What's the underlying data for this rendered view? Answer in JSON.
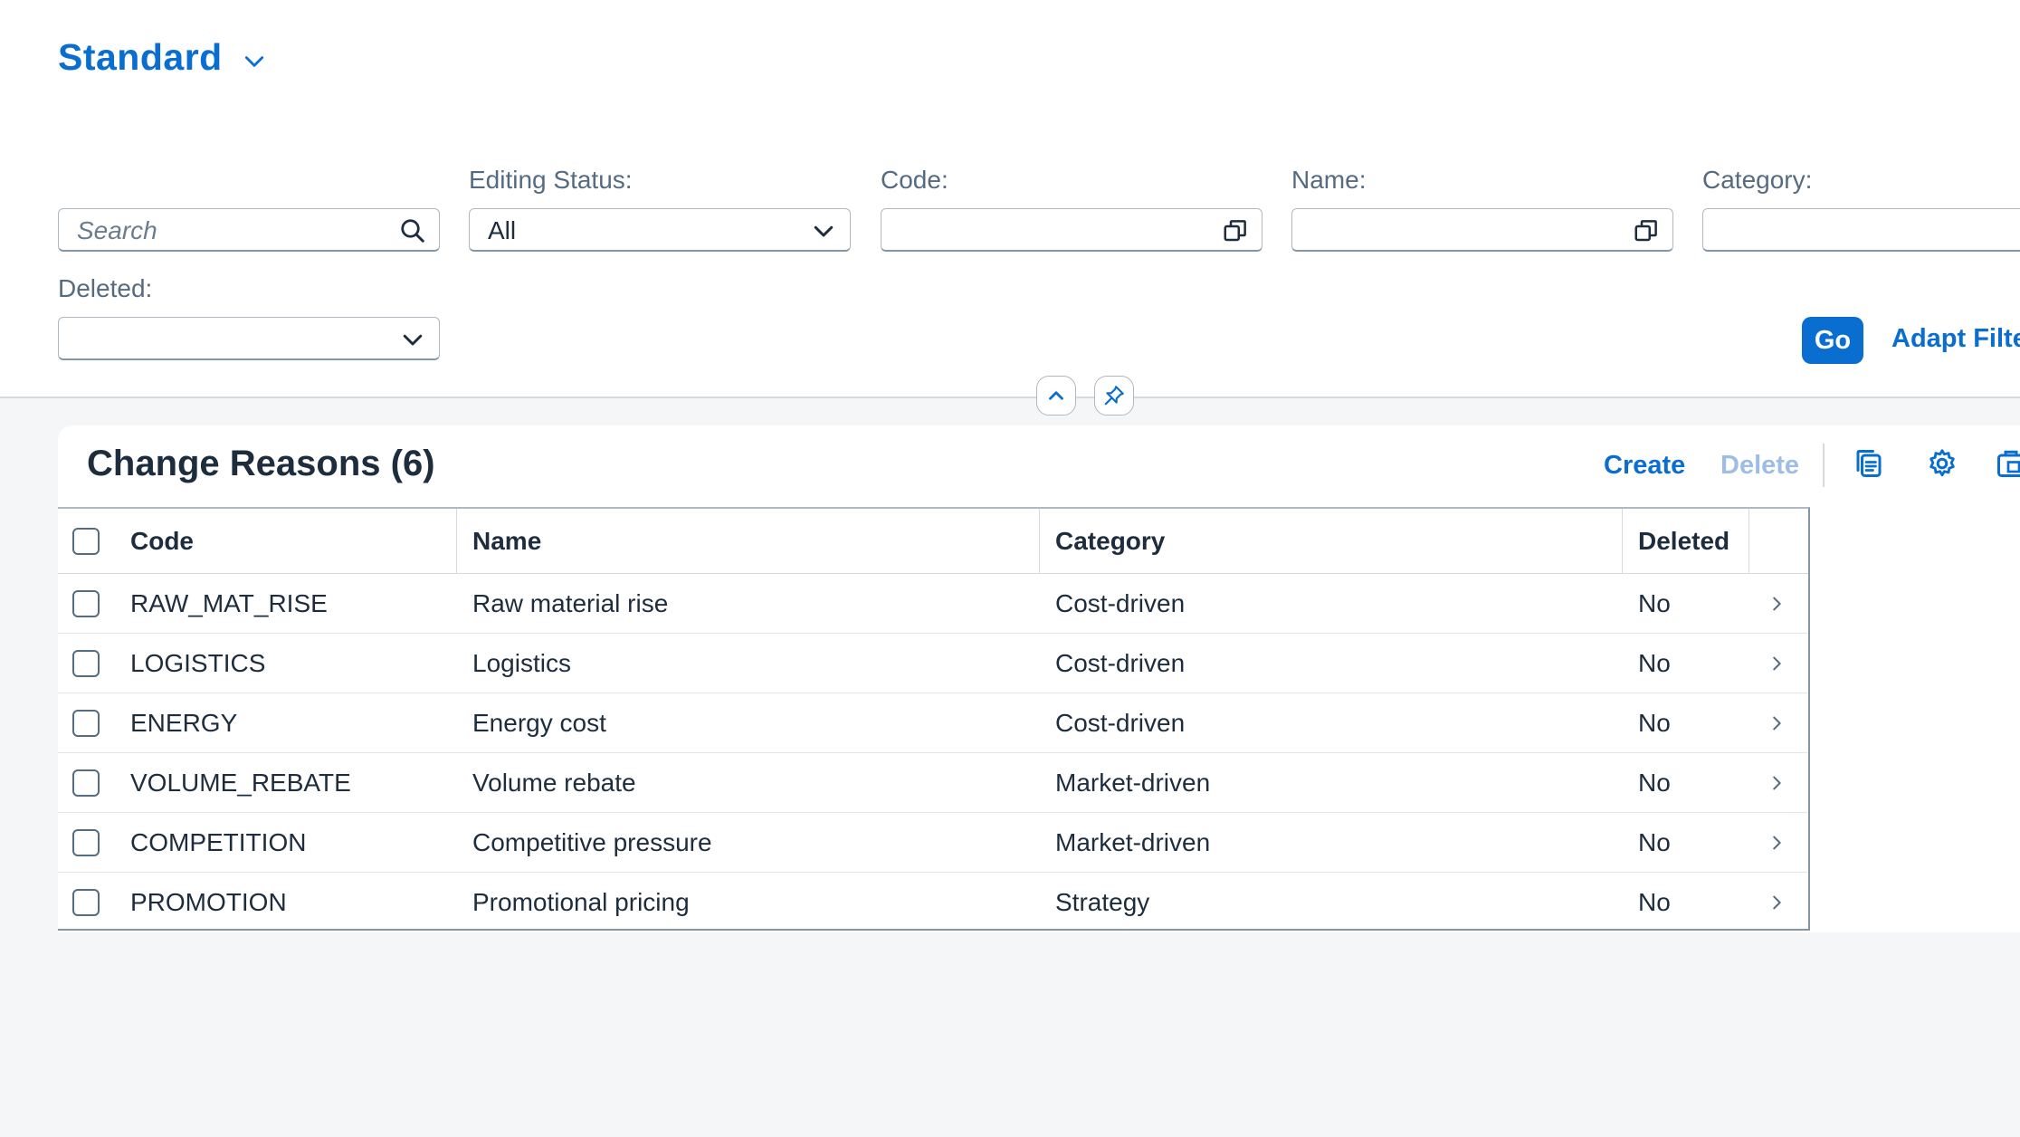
{
  "header": {
    "variant_title": "Standard",
    "filters": {
      "search_placeholder": "Search",
      "editing_status_label": "Editing Status:",
      "editing_status_value": "All",
      "code_label": "Code:",
      "code_value": "",
      "name_label": "Name:",
      "name_value": "",
      "category_label": "Category:",
      "category_value": "",
      "deleted_label": "Deleted:",
      "deleted_value": ""
    },
    "go_label": "Go",
    "adapt_filters_label": "Adapt Filter"
  },
  "table": {
    "title": "Change Reasons (6)",
    "toolbar": {
      "create_label": "Create",
      "delete_label": "Delete"
    },
    "columns": [
      "Code",
      "Name",
      "Category",
      "Deleted"
    ],
    "rows": [
      {
        "code": "RAW_MAT_RISE",
        "name": "Raw material rise",
        "category": "Cost-driven",
        "deleted": "No"
      },
      {
        "code": "LOGISTICS",
        "name": "Logistics",
        "category": "Cost-driven",
        "deleted": "No"
      },
      {
        "code": "ENERGY",
        "name": "Energy cost",
        "category": "Cost-driven",
        "deleted": "No"
      },
      {
        "code": "VOLUME_REBATE",
        "name": "Volume rebate",
        "category": "Market-driven",
        "deleted": "No"
      },
      {
        "code": "COMPETITION",
        "name": "Competitive pressure",
        "category": "Market-driven",
        "deleted": "No"
      },
      {
        "code": "PROMOTION",
        "name": "Promotional pricing",
        "category": "Strategy",
        "deleted": "No"
      }
    ]
  },
  "colors": {
    "accent": "#0a6ed1",
    "disabled": "#9dbde4",
    "background": "#f5f6f7"
  },
  "icons": [
    "chevron-down-icon",
    "search-icon",
    "value-help-icon",
    "chevron-up-icon",
    "pin-icon",
    "copy-icon",
    "settings-icon",
    "export-icon",
    "chevron-right-icon"
  ]
}
